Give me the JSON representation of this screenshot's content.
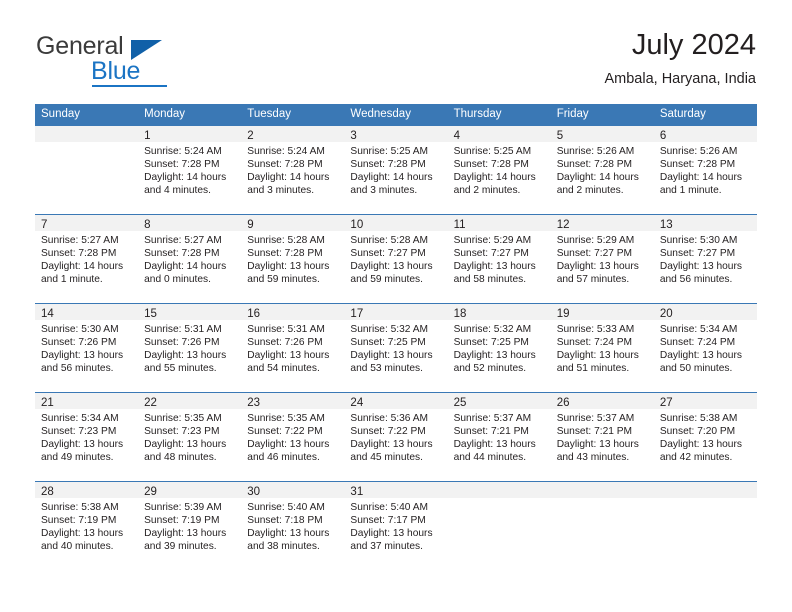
{
  "brand": {
    "name_part1": "General",
    "name_part2": "Blue"
  },
  "header": {
    "title": "July 2024",
    "subtitle": "Ambala, Haryana, India"
  },
  "colors": {
    "header_blue": "#3a78b5",
    "brand_blue": "#1b74c4",
    "day_band_gray": "#f2f2f2",
    "text": "#231f20"
  },
  "weekdays": [
    "Sunday",
    "Monday",
    "Tuesday",
    "Wednesday",
    "Thursday",
    "Friday",
    "Saturday"
  ],
  "weeks": [
    [
      {
        "day": "",
        "sunrise": "",
        "sunset": "",
        "daylight1": "",
        "daylight2": ""
      },
      {
        "day": "1",
        "sunrise": "Sunrise: 5:24 AM",
        "sunset": "Sunset: 7:28 PM",
        "daylight1": "Daylight: 14 hours",
        "daylight2": "and 4 minutes."
      },
      {
        "day": "2",
        "sunrise": "Sunrise: 5:24 AM",
        "sunset": "Sunset: 7:28 PM",
        "daylight1": "Daylight: 14 hours",
        "daylight2": "and 3 minutes."
      },
      {
        "day": "3",
        "sunrise": "Sunrise: 5:25 AM",
        "sunset": "Sunset: 7:28 PM",
        "daylight1": "Daylight: 14 hours",
        "daylight2": "and 3 minutes."
      },
      {
        "day": "4",
        "sunrise": "Sunrise: 5:25 AM",
        "sunset": "Sunset: 7:28 PM",
        "daylight1": "Daylight: 14 hours",
        "daylight2": "and 2 minutes."
      },
      {
        "day": "5",
        "sunrise": "Sunrise: 5:26 AM",
        "sunset": "Sunset: 7:28 PM",
        "daylight1": "Daylight: 14 hours",
        "daylight2": "and 2 minutes."
      },
      {
        "day": "6",
        "sunrise": "Sunrise: 5:26 AM",
        "sunset": "Sunset: 7:28 PM",
        "daylight1": "Daylight: 14 hours",
        "daylight2": "and 1 minute."
      }
    ],
    [
      {
        "day": "7",
        "sunrise": "Sunrise: 5:27 AM",
        "sunset": "Sunset: 7:28 PM",
        "daylight1": "Daylight: 14 hours",
        "daylight2": "and 1 minute."
      },
      {
        "day": "8",
        "sunrise": "Sunrise: 5:27 AM",
        "sunset": "Sunset: 7:28 PM",
        "daylight1": "Daylight: 14 hours",
        "daylight2": "and 0 minutes."
      },
      {
        "day": "9",
        "sunrise": "Sunrise: 5:28 AM",
        "sunset": "Sunset: 7:28 PM",
        "daylight1": "Daylight: 13 hours",
        "daylight2": "and 59 minutes."
      },
      {
        "day": "10",
        "sunrise": "Sunrise: 5:28 AM",
        "sunset": "Sunset: 7:27 PM",
        "daylight1": "Daylight: 13 hours",
        "daylight2": "and 59 minutes."
      },
      {
        "day": "11",
        "sunrise": "Sunrise: 5:29 AM",
        "sunset": "Sunset: 7:27 PM",
        "daylight1": "Daylight: 13 hours",
        "daylight2": "and 58 minutes."
      },
      {
        "day": "12",
        "sunrise": "Sunrise: 5:29 AM",
        "sunset": "Sunset: 7:27 PM",
        "daylight1": "Daylight: 13 hours",
        "daylight2": "and 57 minutes."
      },
      {
        "day": "13",
        "sunrise": "Sunrise: 5:30 AM",
        "sunset": "Sunset: 7:27 PM",
        "daylight1": "Daylight: 13 hours",
        "daylight2": "and 56 minutes."
      }
    ],
    [
      {
        "day": "14",
        "sunrise": "Sunrise: 5:30 AM",
        "sunset": "Sunset: 7:26 PM",
        "daylight1": "Daylight: 13 hours",
        "daylight2": "and 56 minutes."
      },
      {
        "day": "15",
        "sunrise": "Sunrise: 5:31 AM",
        "sunset": "Sunset: 7:26 PM",
        "daylight1": "Daylight: 13 hours",
        "daylight2": "and 55 minutes."
      },
      {
        "day": "16",
        "sunrise": "Sunrise: 5:31 AM",
        "sunset": "Sunset: 7:26 PM",
        "daylight1": "Daylight: 13 hours",
        "daylight2": "and 54 minutes."
      },
      {
        "day": "17",
        "sunrise": "Sunrise: 5:32 AM",
        "sunset": "Sunset: 7:25 PM",
        "daylight1": "Daylight: 13 hours",
        "daylight2": "and 53 minutes."
      },
      {
        "day": "18",
        "sunrise": "Sunrise: 5:32 AM",
        "sunset": "Sunset: 7:25 PM",
        "daylight1": "Daylight: 13 hours",
        "daylight2": "and 52 minutes."
      },
      {
        "day": "19",
        "sunrise": "Sunrise: 5:33 AM",
        "sunset": "Sunset: 7:24 PM",
        "daylight1": "Daylight: 13 hours",
        "daylight2": "and 51 minutes."
      },
      {
        "day": "20",
        "sunrise": "Sunrise: 5:34 AM",
        "sunset": "Sunset: 7:24 PM",
        "daylight1": "Daylight: 13 hours",
        "daylight2": "and 50 minutes."
      }
    ],
    [
      {
        "day": "21",
        "sunrise": "Sunrise: 5:34 AM",
        "sunset": "Sunset: 7:23 PM",
        "daylight1": "Daylight: 13 hours",
        "daylight2": "and 49 minutes."
      },
      {
        "day": "22",
        "sunrise": "Sunrise: 5:35 AM",
        "sunset": "Sunset: 7:23 PM",
        "daylight1": "Daylight: 13 hours",
        "daylight2": "and 48 minutes."
      },
      {
        "day": "23",
        "sunrise": "Sunrise: 5:35 AM",
        "sunset": "Sunset: 7:22 PM",
        "daylight1": "Daylight: 13 hours",
        "daylight2": "and 46 minutes."
      },
      {
        "day": "24",
        "sunrise": "Sunrise: 5:36 AM",
        "sunset": "Sunset: 7:22 PM",
        "daylight1": "Daylight: 13 hours",
        "daylight2": "and 45 minutes."
      },
      {
        "day": "25",
        "sunrise": "Sunrise: 5:37 AM",
        "sunset": "Sunset: 7:21 PM",
        "daylight1": "Daylight: 13 hours",
        "daylight2": "and 44 minutes."
      },
      {
        "day": "26",
        "sunrise": "Sunrise: 5:37 AM",
        "sunset": "Sunset: 7:21 PM",
        "daylight1": "Daylight: 13 hours",
        "daylight2": "and 43 minutes."
      },
      {
        "day": "27",
        "sunrise": "Sunrise: 5:38 AM",
        "sunset": "Sunset: 7:20 PM",
        "daylight1": "Daylight: 13 hours",
        "daylight2": "and 42 minutes."
      }
    ],
    [
      {
        "day": "28",
        "sunrise": "Sunrise: 5:38 AM",
        "sunset": "Sunset: 7:19 PM",
        "daylight1": "Daylight: 13 hours",
        "daylight2": "and 40 minutes."
      },
      {
        "day": "29",
        "sunrise": "Sunrise: 5:39 AM",
        "sunset": "Sunset: 7:19 PM",
        "daylight1": "Daylight: 13 hours",
        "daylight2": "and 39 minutes."
      },
      {
        "day": "30",
        "sunrise": "Sunrise: 5:40 AM",
        "sunset": "Sunset: 7:18 PM",
        "daylight1": "Daylight: 13 hours",
        "daylight2": "and 38 minutes."
      },
      {
        "day": "31",
        "sunrise": "Sunrise: 5:40 AM",
        "sunset": "Sunset: 7:17 PM",
        "daylight1": "Daylight: 13 hours",
        "daylight2": "and 37 minutes."
      },
      {
        "day": "",
        "sunrise": "",
        "sunset": "",
        "daylight1": "",
        "daylight2": ""
      },
      {
        "day": "",
        "sunrise": "",
        "sunset": "",
        "daylight1": "",
        "daylight2": ""
      },
      {
        "day": "",
        "sunrise": "",
        "sunset": "",
        "daylight1": "",
        "daylight2": ""
      }
    ]
  ]
}
